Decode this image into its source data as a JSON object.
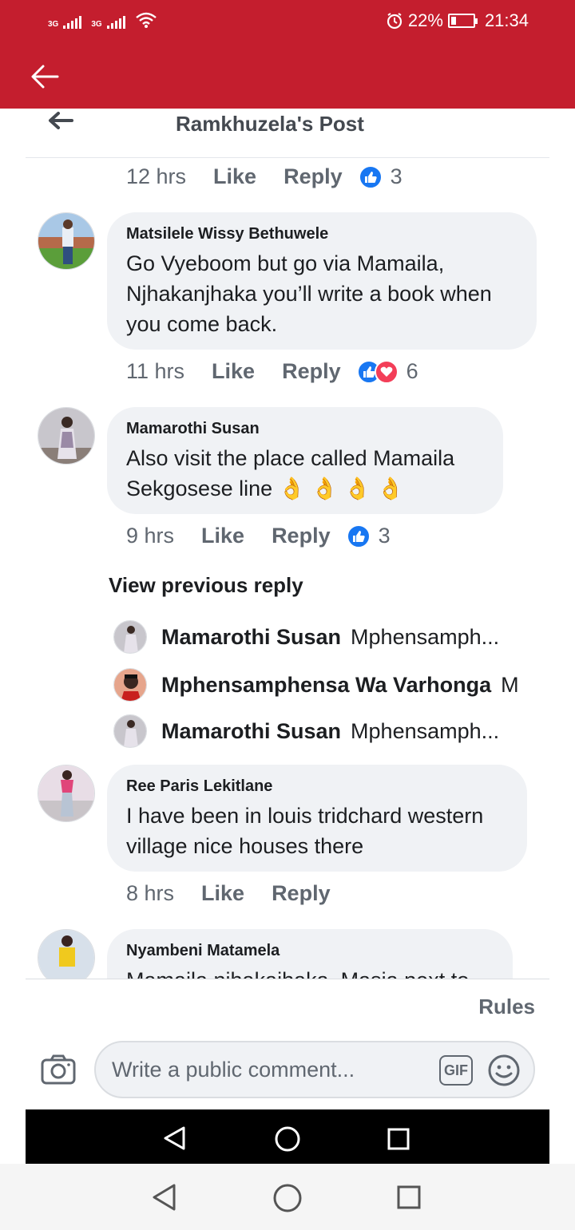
{
  "status": {
    "network1": "3G",
    "network2": "3G",
    "battery_pct": "22%",
    "battery_level": 0.22,
    "time": "21:34"
  },
  "header": {
    "title": "Ramkhuzela's Post"
  },
  "comments": [
    {
      "meta": {
        "time": "12 hrs",
        "like": "Like",
        "reply": "Reply",
        "count": "3",
        "reactions": [
          "like"
        ]
      }
    },
    {
      "author": "Matsilele Wissy Bethuwele",
      "text": "Go Vyeboom but go via Mamaila, Njhakanjhaka you’ll write a book when you come back.",
      "meta": {
        "time": "11 hrs",
        "like": "Like",
        "reply": "Reply",
        "count": "6",
        "reactions": [
          "like",
          "love"
        ]
      }
    },
    {
      "author": "Mamarothi Susan",
      "text": "Also visit the place called Mamaila Sekgosese line 👌 👌 👌 👌",
      "meta": {
        "time": "9 hrs",
        "like": "Like",
        "reply": "Reply",
        "count": "3",
        "reactions": [
          "like"
        ]
      }
    },
    {
      "author": "Ree Paris Lekitlane",
      "text": "I have been in louis tridchard western village nice houses there",
      "meta": {
        "time": "8 hrs",
        "like": "Like",
        "reply": "Reply"
      }
    },
    {
      "author": "Nyambeni Matamela",
      "text": "Mamaila njhakajhaka, Masia next to"
    }
  ],
  "replies": {
    "view_previous": "View previous reply",
    "items": [
      {
        "name": "Mamarothi Susan",
        "text": "Mphensamph..."
      },
      {
        "name": "Mphensamphensa Wa Varhonga",
        "text": "M"
      },
      {
        "name": "Mamarothi Susan",
        "text": "Mphensamph..."
      }
    ]
  },
  "footer": {
    "rules": "Rules",
    "placeholder": "Write a public comment...",
    "gif": "GIF"
  },
  "colors": {
    "brand_red": "#c41e2e",
    "like_blue": "#1877f2",
    "love_red": "#f33e58",
    "bubble": "#f0f2f5"
  },
  "icons": [
    "back-arrow-icon",
    "camera-icon",
    "gif-icon",
    "emoji-icon",
    "like-reaction-icon",
    "love-reaction-icon",
    "nav-back-icon",
    "nav-home-icon",
    "nav-recents-icon"
  ]
}
